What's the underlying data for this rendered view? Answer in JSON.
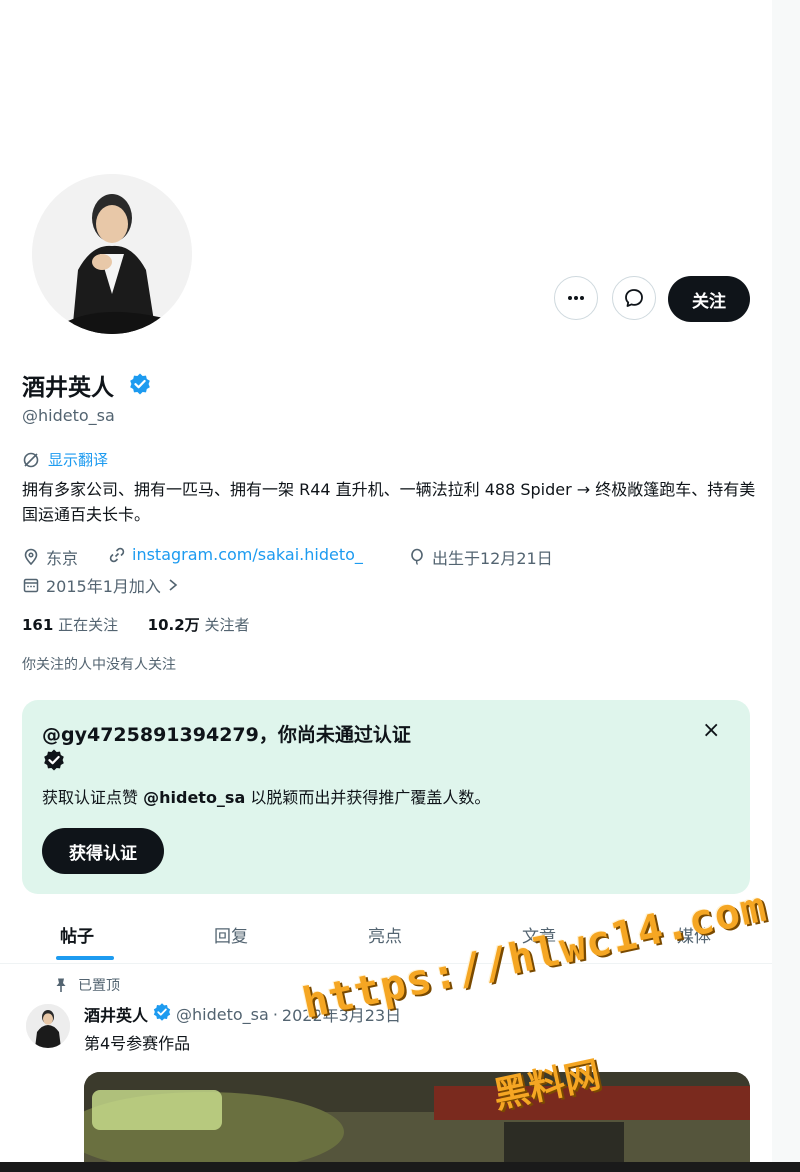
{
  "profile": {
    "name": "酒井英人",
    "handle": "@hideto_sa",
    "translate_label": "显示翻译",
    "bio": "拥有多家公司、拥有一匹马、拥有一架 R44 直升机、一辆法拉利 488 Spider → 终极敞篷跑车、持有美国运通百夫长卡。",
    "location": "东京",
    "website": "instagram.com/sakai.hideto_",
    "birthday": "出生于12月21日",
    "joined": "2015年1月加入",
    "following_count": "161",
    "following_label": "正在关注",
    "followers_count": "10.2万",
    "followers_label": "关注者",
    "followed_by_text": "你关注的人中没有人关注"
  },
  "actions": {
    "follow_label": "关注"
  },
  "verify_card": {
    "title": "@gy4725891394279，你尚未通过认证",
    "body_prefix": "获取认证点赞",
    "body_handle": "@hideto_sa",
    "body_suffix": "以脱颖而出并获得推广覆盖人数。",
    "button_label": "获得认证",
    "close_glyph": "×"
  },
  "tabs": [
    {
      "label": "帖子",
      "active": true
    },
    {
      "label": "回复"
    },
    {
      "label": "亮点"
    },
    {
      "label": "文章"
    },
    {
      "label": "媒体"
    }
  ],
  "pinned_post": {
    "pinned_label": "已置顶",
    "author_name": "酒井英人",
    "author_handle": "@hideto_sa",
    "separator": "·",
    "date": "2022年3月23日",
    "text": "第4号参赛作品"
  },
  "watermark": {
    "url": "https://hlwc14.com",
    "site": "黑料网"
  },
  "colors": {
    "accent": "#1d9bf0",
    "text": "#0f1419",
    "muted": "#536471",
    "card_bg": "#dff5ec",
    "watermark": "#f5a623"
  }
}
